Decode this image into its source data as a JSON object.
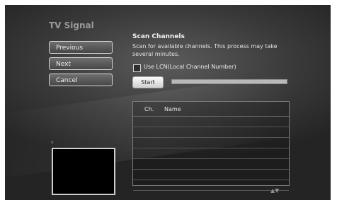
{
  "screen": {
    "title": "TV Signal"
  },
  "nav": {
    "previous_label": "Previous",
    "next_label": "Next",
    "cancel_label": "Cancel"
  },
  "scan": {
    "heading": "Scan Channels",
    "description": "Scan for available channels. This process may take several minutes.",
    "lcn_label": "Use LCN(Local Channel Number)",
    "lcn_checked": false,
    "start_label": "Start",
    "progress_fraction": 0.0
  },
  "channel_list": {
    "columns": [
      "Ch.",
      "Name"
    ],
    "rows": []
  },
  "preview": {
    "label": "▿"
  },
  "scroll": {
    "arrows": "▲▼"
  }
}
